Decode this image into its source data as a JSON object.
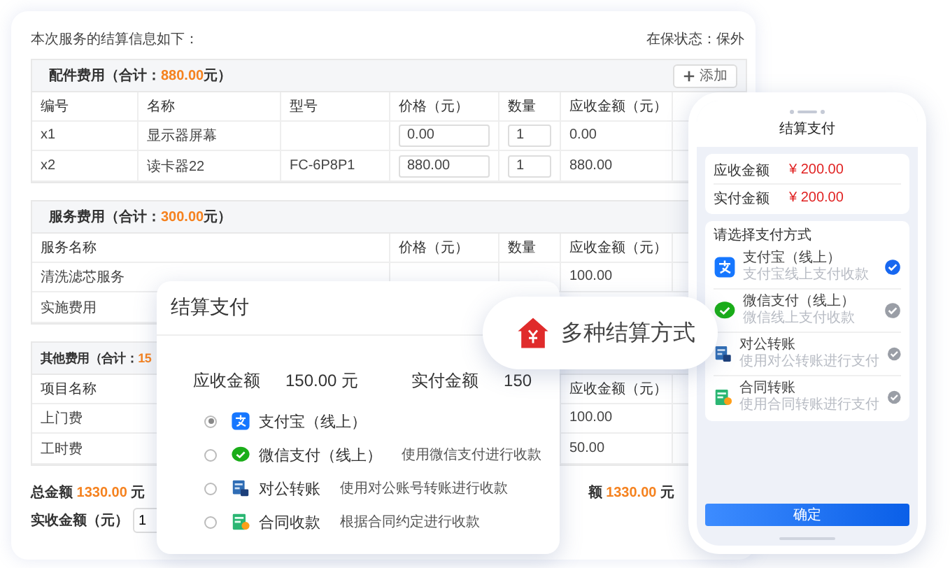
{
  "page": {
    "intro": "本次服务的结算信息如下：",
    "warranty": "在保状态：保外"
  },
  "sections": [
    {
      "kind": "parts",
      "title": "配件费用（合计：**880.00**元）",
      "add_button": "添加",
      "columns": [
        "编号",
        "名称",
        "型号",
        "价格（元）",
        "数量",
        "应收金额（元）"
      ],
      "rows": [
        {
          "no": "x1",
          "name": "显示器屏幕",
          "price": "0.00",
          "qty": "1",
          "amount": "0.00"
        },
        {
          "no": "x2",
          "name": "读卡器22",
          "model": "FC-6P8P1",
          "price": "880.00",
          "qty": "1",
          "amount": "880.00"
        }
      ]
    },
    {
      "kind": "services",
      "title": "服务费用（合计：**300.00**元）",
      "columns": [
        "服务名称",
        "价格（元）",
        "数量",
        "应收金额（元）"
      ],
      "rows": [
        {
          "name": "清洗滤芯服务",
          "amount": "100.00"
        },
        {
          "name": "实施费用"
        }
      ]
    },
    {
      "kind": "other",
      "title": "其他费用（合计：**15**",
      "columns": [
        "项目名称",
        "应收金额（元）"
      ],
      "rows": [
        {
          "name": "上门费",
          "amount": "100.00"
        },
        {
          "name": "工时费",
          "amount": "50.00"
        }
      ]
    }
  ],
  "footer": {
    "total": "总金额 **1330.00** 元",
    "received_total": "额 **1330.00** 元",
    "received_label": "实收金额（元）",
    "received_value": "1"
  },
  "payment_dialog": {
    "title": "结算支付",
    "due_label": "应收金额",
    "due_value": "150.00 元",
    "paid_label": "实付金额",
    "paid_value": "150",
    "methods": [
      {
        "kind": "alipay",
        "label": "支付宝（线上）",
        "selected": true
      },
      {
        "kind": "wechat",
        "label": "微信支付（线上）",
        "note": "使用微信支付进行收款",
        "selected": false
      },
      {
        "kind": "transfer",
        "label": "对公转账",
        "note": "使用对公账号转账进行收款",
        "selected": false
      },
      {
        "kind": "contract",
        "label": "合同收款",
        "note": "根据合同约定进行收款",
        "selected": false
      }
    ]
  },
  "badge": {
    "label": "多种结算方式"
  },
  "phone": {
    "title": "结算支付",
    "amounts": [
      {
        "label": "应收金额",
        "value": "¥ 200.00"
      },
      {
        "label": "实付金额",
        "value": "¥ 200.00"
      }
    ],
    "prompt": "请选择支付方式",
    "methods": [
      {
        "kind": "alipay",
        "label": "支付宝（线上）",
        "note": "支付宝线上支付收款",
        "selected": true
      },
      {
        "kind": "wechat",
        "label": "微信支付（线上）",
        "note": "微信线上支付收款",
        "selected": false
      },
      {
        "kind": "transfer",
        "label": "对公转账",
        "note": "使用对公转账进行支付",
        "selected": false
      },
      {
        "kind": "contract",
        "label": "合同转账",
        "note": "使用合同转账进行支付",
        "selected": false
      }
    ],
    "confirm": "确定"
  }
}
